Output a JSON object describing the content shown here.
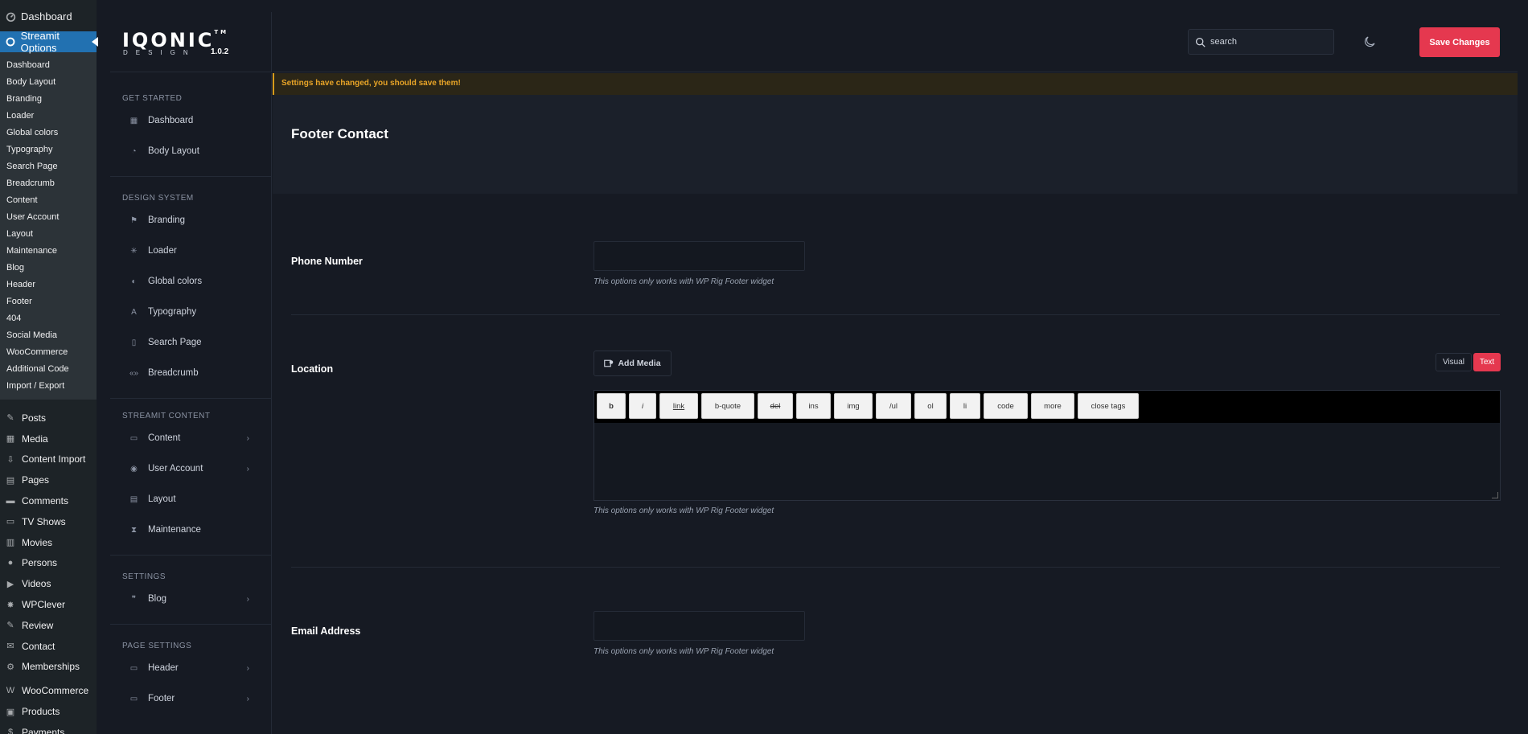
{
  "wp_menu": {
    "dashboard": "Dashboard",
    "streamit_options": "Streamit Options",
    "sub_items": [
      "Dashboard",
      "Body Layout",
      "Branding",
      "Loader",
      "Global colors",
      "Typography",
      "Search Page",
      "Breadcrumb",
      "Content",
      "User Account",
      "Layout",
      "Maintenance",
      "Blog",
      "Header",
      "Footer",
      "404",
      "Social Media",
      "WooCommerce",
      "Additional Code",
      "Import / Export"
    ],
    "items_a": [
      {
        "label": "Posts",
        "icon": "pin-icon"
      },
      {
        "label": "Media",
        "icon": "media-icon"
      },
      {
        "label": "Content Import",
        "icon": "import-icon"
      },
      {
        "label": "Pages",
        "icon": "pages-icon"
      },
      {
        "label": "Comments",
        "icon": "comments-icon"
      },
      {
        "label": "TV Shows",
        "icon": "tv-icon"
      },
      {
        "label": "Movies",
        "icon": "film-icon"
      },
      {
        "label": "Persons",
        "icon": "person-icon"
      },
      {
        "label": "Videos",
        "icon": "video-icon"
      },
      {
        "label": "WPClever",
        "icon": "wpclever-icon"
      },
      {
        "label": "Review",
        "icon": "review-icon"
      },
      {
        "label": "Contact",
        "icon": "mail-icon"
      },
      {
        "label": "Memberships",
        "icon": "members-icon"
      }
    ],
    "items_b": [
      {
        "label": "WooCommerce",
        "icon": "woo-icon"
      },
      {
        "label": "Products",
        "icon": "products-icon"
      },
      {
        "label": "Payments",
        "icon": "payments-icon"
      }
    ]
  },
  "brand": {
    "logo": "IQONIC",
    "logo_sub": "DESIGN",
    "version": "1.0.2"
  },
  "topbar": {
    "search_placeholder": "search",
    "save_label": "Save Changes"
  },
  "nav": {
    "get_started": "GET STARTED",
    "get_started_items": [
      {
        "label": "Dashboard",
        "icon": "grid-icon"
      },
      {
        "label": "Body Layout",
        "icon": "gauge-icon"
      }
    ],
    "design_system": "DESIGN SYSTEM",
    "design_items": [
      {
        "label": "Branding",
        "icon": "flag-icon"
      },
      {
        "label": "Loader",
        "icon": "loader-icon"
      },
      {
        "label": "Global colors",
        "icon": "drop-icon"
      },
      {
        "label": "Typography",
        "icon": "type-icon"
      },
      {
        "label": "Search Page",
        "icon": "file-icon"
      },
      {
        "label": "Breadcrumb",
        "icon": "code-icon"
      }
    ],
    "streamit_content": "STREAMIT CONTENT",
    "content_items": [
      {
        "label": "Content",
        "icon": "window-icon",
        "chevron": true
      },
      {
        "label": "User Account",
        "icon": "user-circle-icon",
        "chevron": true
      },
      {
        "label": "Layout",
        "icon": "layout-icon",
        "chevron": false
      },
      {
        "label": "Maintenance",
        "icon": "hourglass-icon",
        "chevron": false
      }
    ],
    "settings": "SETTINGS",
    "settings_items": [
      {
        "label": "Blog",
        "icon": "quote-icon",
        "chevron": true
      }
    ],
    "page_settings": "PAGE SETTINGS",
    "page_items": [
      {
        "label": "Header",
        "icon": "window-icon",
        "chevron": true
      },
      {
        "label": "Footer",
        "icon": "window-icon",
        "chevron": true
      }
    ]
  },
  "notice": "Settings have changed, you should save them!",
  "page_title": "Footer Contact",
  "fields": {
    "phone_label": "Phone Number",
    "phone_value": "",
    "hint": "This options only works with WP Rig Footer widget",
    "location_label": "Location",
    "add_media": "Add Media",
    "tab_visual": "Visual",
    "tab_text": "Text",
    "quicktags": [
      "b",
      "i",
      "link",
      "b-quote",
      "del",
      "ins",
      "img",
      "/ul",
      "ol",
      "li",
      "code",
      "more",
      "close tags"
    ],
    "location_value": "",
    "email_label": "Email Address",
    "email_value": ""
  },
  "colors": {
    "accent": "#e5384f",
    "wp_active": "#2271b1",
    "notice_text": "#e8a427"
  }
}
